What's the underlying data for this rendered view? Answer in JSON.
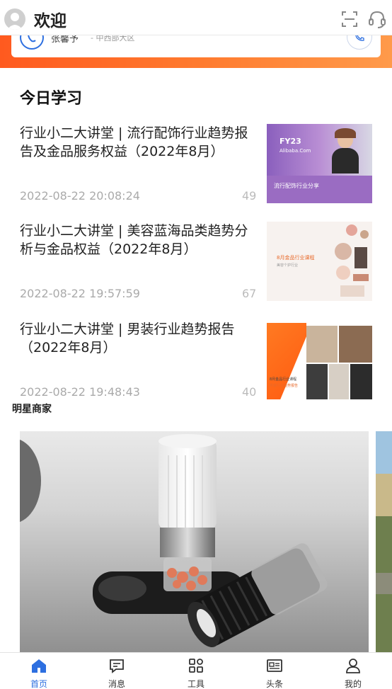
{
  "header": {
    "title": "欢迎",
    "icons": [
      "avatar-icon",
      "scan-icon",
      "customer-service-icon"
    ]
  },
  "contact_card": {
    "name": "张馨予",
    "region": "- 中西部大区"
  },
  "study": {
    "title": "今日学习",
    "articles": [
      {
        "title": "行业小二大讲堂 | 流行配饰行业趋势报告及金品服务权益（2022年8月）",
        "date": "2022-08-22 20:08:24",
        "count": "49",
        "thumb": {
          "brand": "FY23",
          "sub": "Alibaba.Com",
          "caption": "流行配饰行业分享"
        }
      },
      {
        "title": "行业小二大讲堂 | 美容蓝海品类趋势分析与金品权益（2022年8月）",
        "date": "2022-08-22 19:57:59",
        "count": "67",
        "thumb": {
          "line1": "8月金品行业课程",
          "line2": "美容个护行业"
        }
      },
      {
        "title": "行业小二大讲堂 | 男装行业趋势报告（2022年8月）",
        "date": "2022-08-22 19:48:43",
        "count": "40",
        "thumb": {
          "line1": "8月金品行业课程",
          "line2": "男装行业趋势报告"
        }
      }
    ]
  },
  "stars": {
    "label": "明星商家"
  },
  "tabbar": {
    "items": [
      {
        "label": "首页",
        "icon": "home-icon",
        "active": true
      },
      {
        "label": "消息",
        "icon": "message-icon",
        "active": false
      },
      {
        "label": "工具",
        "icon": "tools-icon",
        "active": false
      },
      {
        "label": "头条",
        "icon": "news-icon",
        "active": false
      },
      {
        "label": "我的",
        "icon": "profile-icon",
        "active": false
      }
    ]
  },
  "colors": {
    "accent": "#2d6fe0",
    "brand_orange": "#ff6a26",
    "thumb1_purple": "#7b4fb0"
  }
}
